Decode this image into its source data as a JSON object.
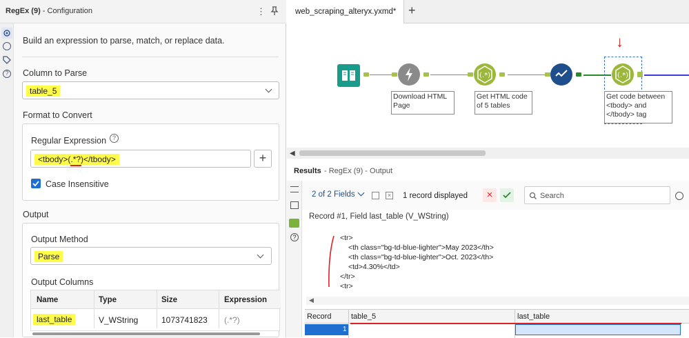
{
  "config": {
    "title_tool": "RegEx (9)",
    "title_rest": " - Configuration",
    "description": "Build an expression to parse, match, or replace data.",
    "column_to_parse_label": "Column to Parse",
    "column_to_parse_value": "table_5",
    "format_label": "Format to Convert",
    "regex_label": "Regular Expression",
    "regex_value": "<tbody>(.*?)</tbody>",
    "add_label": "+",
    "case_insensitive_label": "Case Insensitive",
    "case_insensitive_checked": true,
    "output_label": "Output",
    "output_method_label": "Output Method",
    "output_method_value": "Parse",
    "output_columns_label": "Output Columns",
    "columns_headers": [
      "Name",
      "Type",
      "Size",
      "Expression"
    ],
    "columns_rows": [
      [
        "last_table",
        "V_WString",
        "1073741823",
        "(.*?)"
      ]
    ]
  },
  "workflow": {
    "tab_name": "web_scraping_alteryx.yxmd*",
    "new_tab_label": "+",
    "annotations": {
      "download": [
        "Download HTML",
        "Page"
      ],
      "get_html": [
        "Get HTML code",
        "of 5 tables"
      ],
      "get_code": [
        "Get code between",
        "<tbody> and",
        "</tbody> tag"
      ]
    },
    "arrow_mark": "↓"
  },
  "results": {
    "title_bold": "Results",
    "title_rest": " - RegEx (9) - Output",
    "fields_label": "2 of 2 Fields",
    "records_label": "1 record displayed",
    "search_placeholder": "Search",
    "record_info": "Record #1, Field last_table (V_WString)",
    "content_lines": [
      "<tr>",
      "<th class=\"bg-td-blue-lighter\">May 2023</th>",
      "<th class=\"bg-td-blue-lighter\">Oct. 2023</th>",
      "<td>4.30%</td>",
      "</tr>",
      "<tr>"
    ],
    "grid_headers": [
      "Record",
      "table_5",
      "last_table"
    ],
    "grid_row_num": "1"
  },
  "colors": {
    "highlight": "#fffb4a",
    "accent": "#1f6fd0",
    "annotation_red": "#e02020"
  }
}
